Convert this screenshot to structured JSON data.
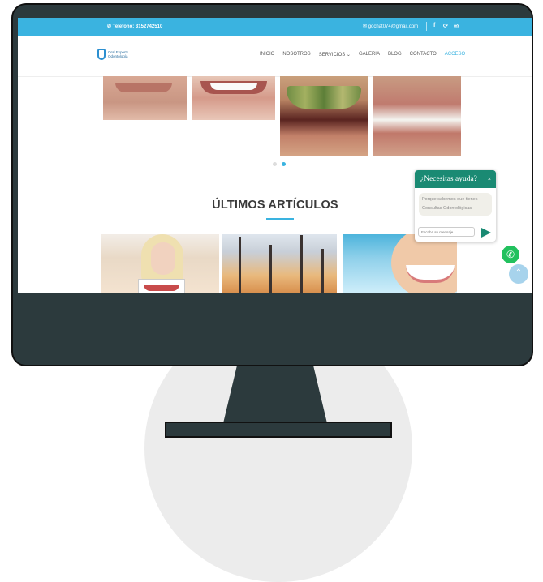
{
  "topbar": {
    "phone": "✆ Telefono: 3152742510",
    "email": "✉ gochat074@gmail.com",
    "social": [
      "f",
      "⟳",
      "◎"
    ]
  },
  "logo": {
    "line1": "Oral Experts",
    "line2": "Odontología"
  },
  "nav": {
    "items": [
      "INICIO",
      "NOSOTROS",
      "SERVICIOS ⌄",
      "GALERIA",
      "BLOG",
      "CONTACTO",
      "ACCESO"
    ],
    "active": "ACCESO"
  },
  "section": {
    "heading": "ÚLTIMOS ARTÍCULOS"
  },
  "chat": {
    "title": "¿Necesitas ayuda?",
    "close": "×",
    "message": "Porque sabemos que tienes Consultas Odontológicas",
    "placeholder": "Escriba su mensaje..."
  },
  "colors": {
    "accent": "#3ab3e0",
    "whatsapp": "#22c15e",
    "chat_header": "#1a8a73",
    "monitor": "#2c3a3d"
  },
  "icons": [
    "phone-icon",
    "mail-icon",
    "facebook-icon",
    "whatsapp-icon",
    "instagram-icon",
    "close-icon",
    "send-icon",
    "scroll-up-icon"
  ]
}
